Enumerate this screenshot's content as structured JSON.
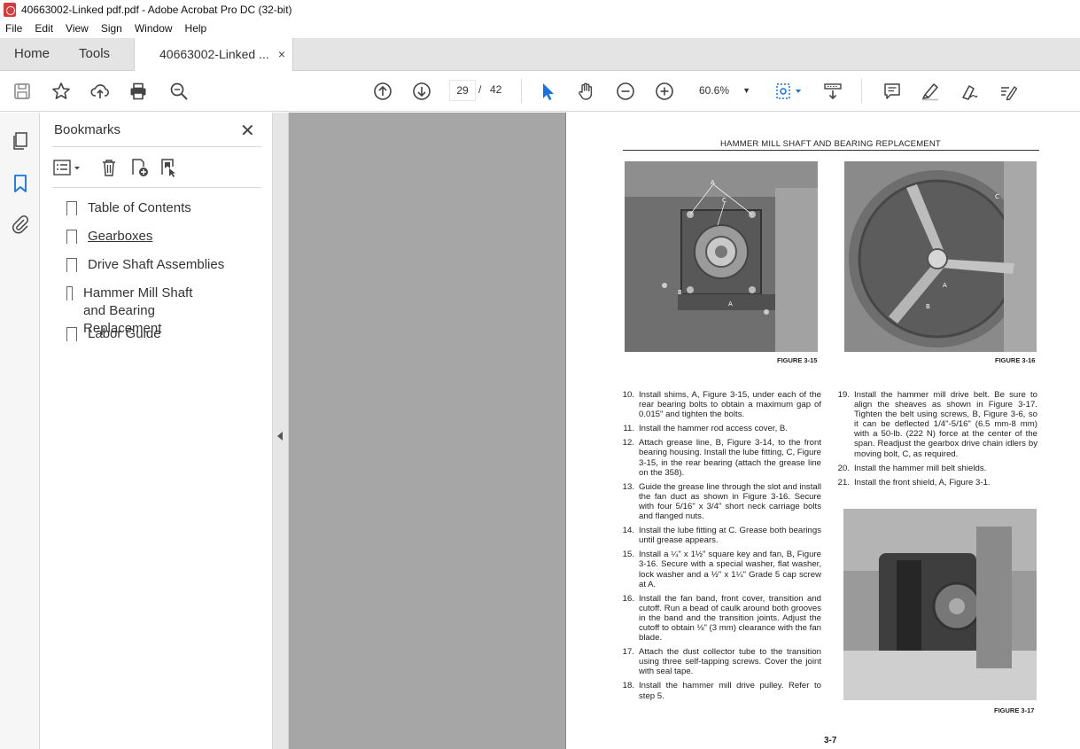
{
  "window": {
    "title": "40663002-Linked pdf.pdf - Adobe Acrobat Pro DC (32-bit)"
  },
  "menu": [
    "File",
    "Edit",
    "View",
    "Sign",
    "Window",
    "Help"
  ],
  "tabs": {
    "home": "Home",
    "tools": "Tools",
    "document": "40663002-Linked ...",
    "close": "×"
  },
  "toolbar": {
    "page_current": "29",
    "page_separator": "/",
    "page_total": "42",
    "zoom": "60.6%",
    "icons": [
      "save-icon",
      "star-icon",
      "upload-icon",
      "print-icon",
      "zoom-search-icon",
      "page-up-icon",
      "page-down-icon",
      "select-cursor-icon",
      "hand-icon",
      "zoom-out-icon",
      "zoom-in-icon",
      "marquee-zoom-icon",
      "scroll-mode-icon",
      "comment-icon",
      "highlight-pen-icon",
      "sign-icon",
      "fill-sign-icon"
    ]
  },
  "bookmarks": {
    "title": "Bookmarks",
    "close": "✕",
    "items": [
      {
        "label": "Table of Contents"
      },
      {
        "label": "Gearboxes"
      },
      {
        "label": "Drive Shaft Assemblies"
      },
      {
        "label": "Hammer Mill Shaft and Bearing Replacement"
      },
      {
        "label": "Labor Guide"
      }
    ]
  },
  "page": {
    "header": "HAMMER MILL SHAFT AND BEARING REPLACEMENT",
    "fig15": "FIGURE 3-15",
    "fig16": "FIGURE 3-16",
    "fig17": "FIGURE 3-17",
    "page_number": "3-7",
    "left_steps": [
      {
        "num": "10.",
        "text": "Install shims, A, Figure 3-15, under each of the rear bearing bolts to obtain a maximum gap of 0.015\" and tighten the bolts."
      },
      {
        "num": "11.",
        "text": "Install the hammer rod access cover, B."
      },
      {
        "num": "12.",
        "text": "Attach grease line, B, Figure 3-14, to the front bearing housing. Install the lube fitting, C, Figure 3-15, in the rear bearing (attach the grease line on the 358)."
      },
      {
        "num": "13.",
        "text": "Guide the grease line through the slot and install the fan duct as shown in Figure 3-16. Secure with four 5/16\" x 3/4\" short neck carriage bolts and flanged nuts."
      },
      {
        "num": "14.",
        "text": "Install the lube fitting at C. Grease both bearings until grease appears."
      },
      {
        "num": "15.",
        "text": "Install a ¼\" x 1½\" square key and fan, B, Figure 3-16. Secure with a special washer, flat washer, lock washer and a ½\" x 1¼\" Grade 5 cap screw at A."
      },
      {
        "num": "16.",
        "text": "Install the fan band, front cover, transition and cutoff. Run a bead of caulk around both grooves in the band and the transition joints. Adjust the cutoff to obtain ⅛\" (3 mm) clearance with the fan blade."
      },
      {
        "num": "17.",
        "text": "Attach the dust collector tube to the transition using three self-tapping screws. Cover the joint with seal tape."
      },
      {
        "num": "18.",
        "text": "Install the hammer mill drive pulley. Refer to step 5."
      }
    ],
    "right_steps": [
      {
        "num": "19.",
        "text": "Install the hammer mill drive belt. Be sure to align the sheaves as shown in Figure 3-17. Tighten the belt using screws, B, Figure 3-6, so it can be deflected 1/4\"-5/16\" (6.5 mm-8 mm) with a 50-lb. (222 N) force at the center of the span. Readjust the gearbox drive chain idlers by moving bolt, C, as required."
      },
      {
        "num": "20.",
        "text": "Install the hammer mill belt shields."
      },
      {
        "num": "21.",
        "text": "Install the front shield, A, Figure 3-1."
      }
    ],
    "photo_labels": {
      "fig15": [
        "A",
        "C",
        "B",
        "A"
      ],
      "fig16": [
        "C",
        "A",
        "B"
      ]
    }
  }
}
